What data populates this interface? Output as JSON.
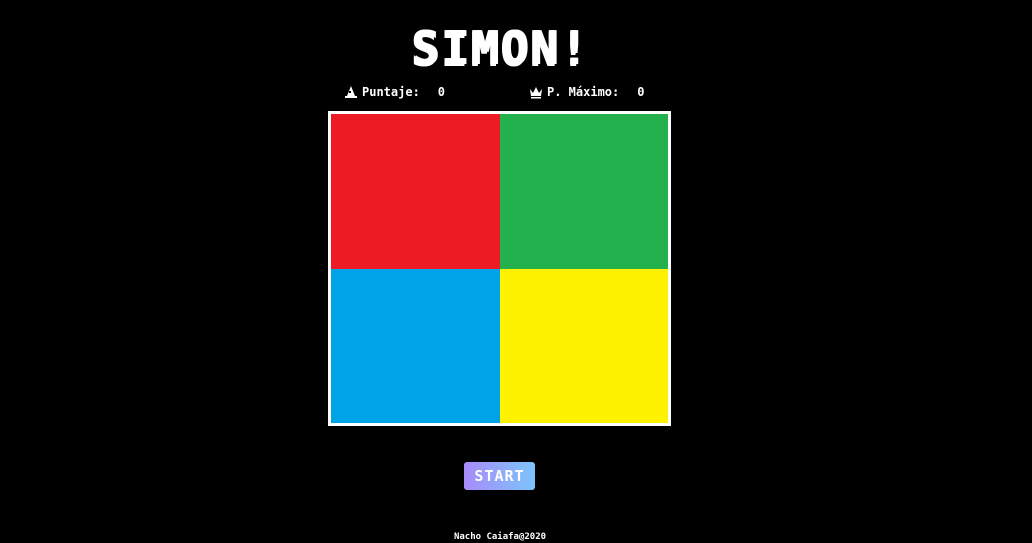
{
  "title": "SIMON!",
  "scores": {
    "current_label": "Puntaje:",
    "current_value": "0",
    "current_icon": "wizard-hat-icon",
    "best_label": "P. Máximo:",
    "best_value": "0",
    "best_icon": "crown-icon"
  },
  "pads": [
    {
      "name": "red",
      "color": "#ED1C24"
    },
    {
      "name": "green",
      "color": "#22B14C"
    },
    {
      "name": "blue",
      "color": "#00A2E8"
    },
    {
      "name": "yellow",
      "color": "#FFF200"
    }
  ],
  "start_label": "START",
  "footer": "Nacho Caiafa@2020"
}
